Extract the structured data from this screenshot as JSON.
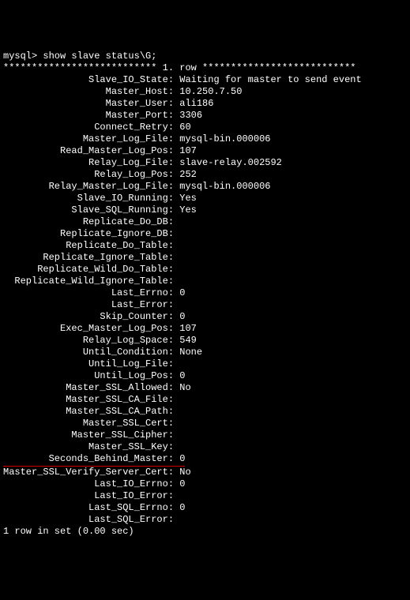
{
  "prompt": "mysql> show slave status\\G;",
  "row_header": "*************************** 1. row ***************************",
  "fields": [
    {
      "label": "Slave_IO_State",
      "value": "Waiting for master to send event",
      "underline": false
    },
    {
      "label": "Master_Host",
      "value": "10.250.7.50",
      "underline": false
    },
    {
      "label": "Master_User",
      "value": "ali186",
      "underline": false
    },
    {
      "label": "Master_Port",
      "value": "3306",
      "underline": false
    },
    {
      "label": "Connect_Retry",
      "value": "60",
      "underline": false
    },
    {
      "label": "Master_Log_File",
      "value": "mysql-bin.000006",
      "underline": false
    },
    {
      "label": "Read_Master_Log_Pos",
      "value": "107",
      "underline": false
    },
    {
      "label": "Relay_Log_File",
      "value": "slave-relay.002592",
      "underline": false
    },
    {
      "label": "Relay_Log_Pos",
      "value": "252",
      "underline": false
    },
    {
      "label": "Relay_Master_Log_File",
      "value": "mysql-bin.000006",
      "underline": false
    },
    {
      "label": "Slave_IO_Running",
      "value": "Yes",
      "underline": false
    },
    {
      "label": "Slave_SQL_Running",
      "value": "Yes",
      "underline": false
    },
    {
      "label": "Replicate_Do_DB",
      "value": "",
      "underline": false
    },
    {
      "label": "Replicate_Ignore_DB",
      "value": "",
      "underline": false
    },
    {
      "label": "Replicate_Do_Table",
      "value": "",
      "underline": false
    },
    {
      "label": "Replicate_Ignore_Table",
      "value": "",
      "underline": false
    },
    {
      "label": "Replicate_Wild_Do_Table",
      "value": "",
      "underline": false
    },
    {
      "label": "Replicate_Wild_Ignore_Table",
      "value": "",
      "underline": false
    },
    {
      "label": "Last_Errno",
      "value": "0",
      "underline": false
    },
    {
      "label": "Last_Error",
      "value": "",
      "underline": false
    },
    {
      "label": "Skip_Counter",
      "value": "0",
      "underline": false
    },
    {
      "label": "Exec_Master_Log_Pos",
      "value": "107",
      "underline": false
    },
    {
      "label": "Relay_Log_Space",
      "value": "549",
      "underline": false
    },
    {
      "label": "Until_Condition",
      "value": "None",
      "underline": false
    },
    {
      "label": "Until_Log_File",
      "value": "",
      "underline": false
    },
    {
      "label": "Until_Log_Pos",
      "value": "0",
      "underline": false
    },
    {
      "label": "Master_SSL_Allowed",
      "value": "No",
      "underline": false
    },
    {
      "label": "Master_SSL_CA_File",
      "value": "",
      "underline": false
    },
    {
      "label": "Master_SSL_CA_Path",
      "value": "",
      "underline": false
    },
    {
      "label": "Master_SSL_Cert",
      "value": "",
      "underline": false
    },
    {
      "label": "Master_SSL_Cipher",
      "value": "",
      "underline": false
    },
    {
      "label": "Master_SSL_Key",
      "value": "",
      "underline": false
    },
    {
      "label": "Seconds_Behind_Master",
      "value": "0",
      "underline": true
    },
    {
      "label": "Master_SSL_Verify_Server_Cert",
      "value": "No",
      "underline": false
    },
    {
      "label": "Last_IO_Errno",
      "value": "0",
      "underline": false
    },
    {
      "label": "Last_IO_Error",
      "value": "",
      "underline": false
    },
    {
      "label": "Last_SQL_Errno",
      "value": "0",
      "underline": false
    },
    {
      "label": "Last_SQL_Error",
      "value": "",
      "underline": false
    }
  ],
  "footer": "1 row in set (0.00 sec)",
  "label_width": 29
}
